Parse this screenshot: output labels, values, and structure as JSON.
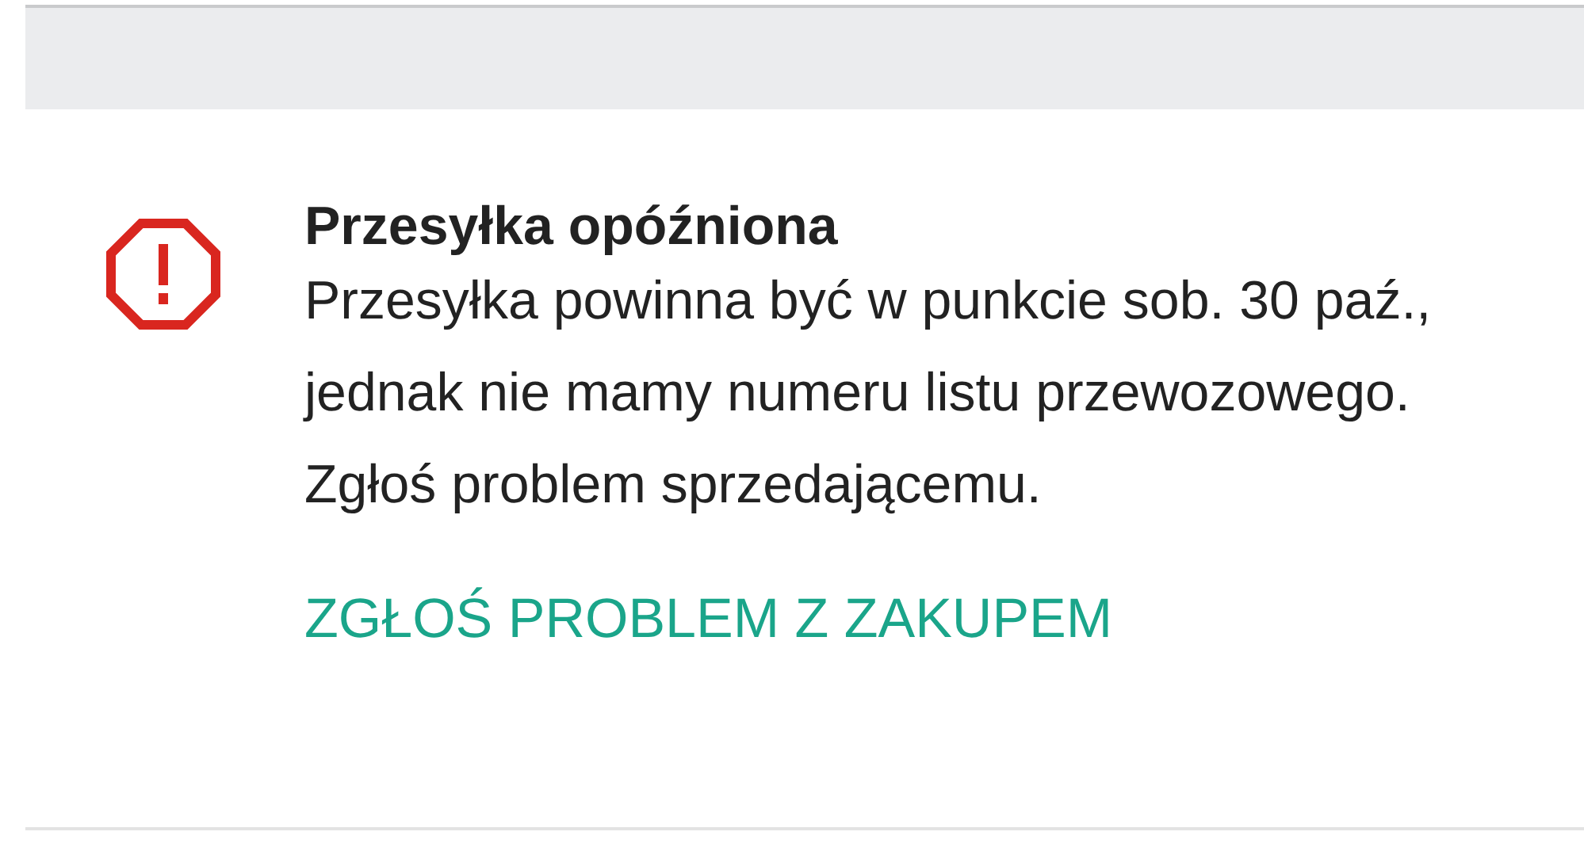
{
  "notice": {
    "kind": "error",
    "title": "Przesyłka opóźniona",
    "message": "Przesyłka powinna być w punkcie sob. 30 paź., jednak nie mamy numeru listu przewozowego. Zgłoś problem sprzedającemu.",
    "action": "ZGŁOŚ PROBLEM Z ZAKUPEM"
  }
}
